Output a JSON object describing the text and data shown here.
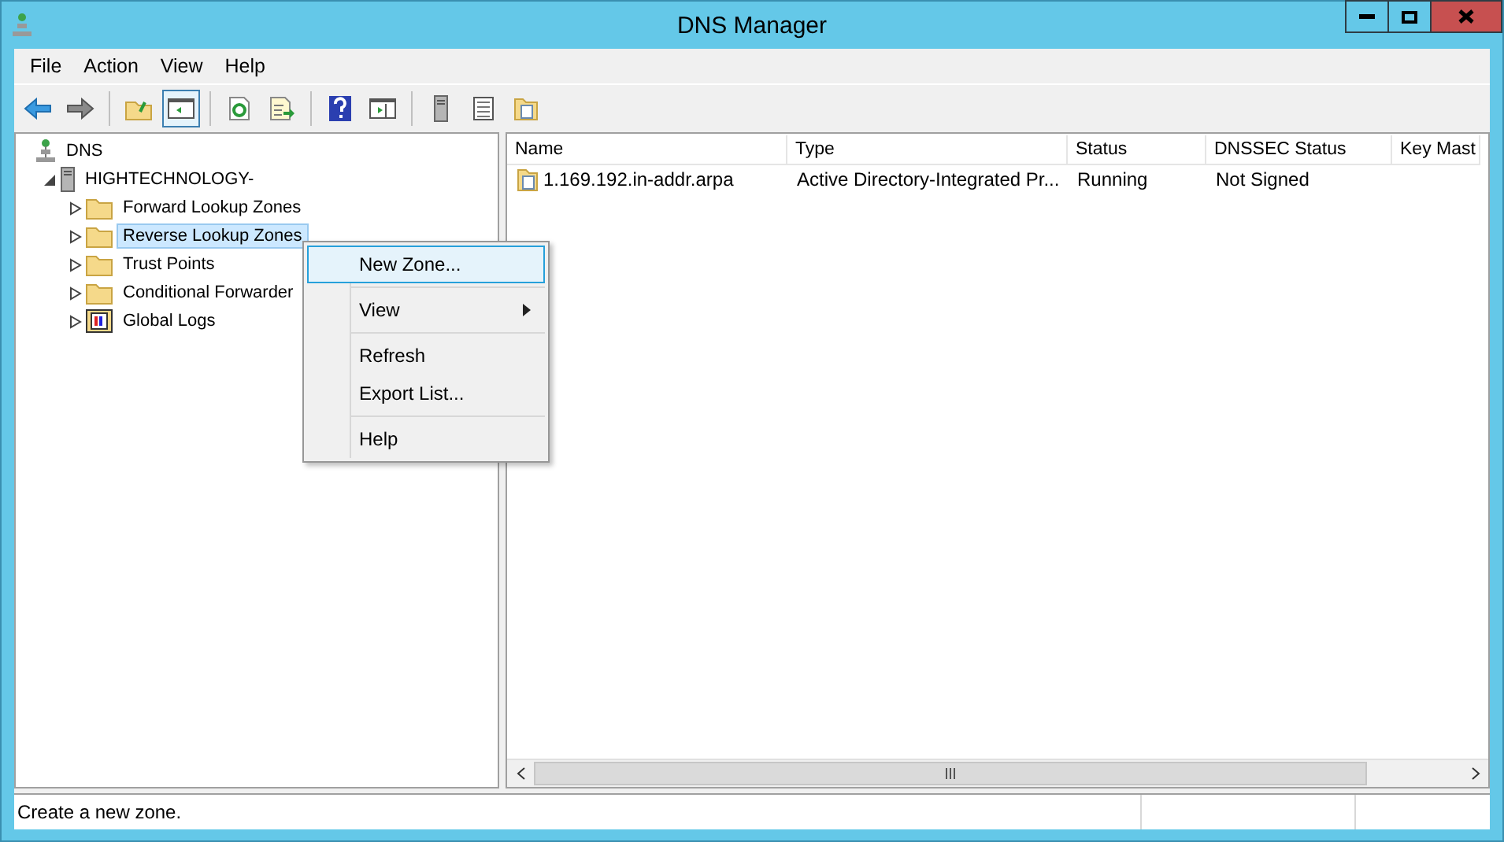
{
  "window": {
    "title": "DNS Manager"
  },
  "menu_bar": [
    "File",
    "Action",
    "View",
    "Help"
  ],
  "tree": [
    {
      "label": "DNS",
      "kind": "dns",
      "selected": false,
      "children": [
        {
          "label": "HIGHTECHNOLOGY-",
          "kind": "server",
          "selected": false,
          "expanded": true,
          "children": [
            {
              "label": "Forward Lookup Zones",
              "kind": "folder",
              "selected": false,
              "expanded": false
            },
            {
              "label": "Reverse Lookup Zones",
              "kind": "folder",
              "selected": true,
              "expanded": false
            },
            {
              "label": "Trust Points",
              "kind": "folder",
              "selected": false,
              "expanded": false
            },
            {
              "label": "Conditional Forwarder",
              "kind": "folder",
              "selected": false,
              "expanded": false
            },
            {
              "label": "Global Logs",
              "kind": "logs",
              "selected": false,
              "expanded": false
            }
          ]
        }
      ]
    }
  ],
  "context_menu": [
    [
      {
        "label": "New Zone...",
        "selected": true,
        "submenu": false
      }
    ],
    [
      {
        "label": "View",
        "selected": false,
        "submenu": true
      }
    ],
    [
      {
        "label": "Refresh",
        "selected": false,
        "submenu": false
      },
      {
        "label": "Export List...",
        "selected": false,
        "submenu": false
      }
    ],
    [
      {
        "label": "Help",
        "selected": false,
        "submenu": false
      }
    ]
  ],
  "table": {
    "columns": [
      "Name",
      "Type",
      "Status",
      "DNSSEC Status",
      "Key Mast"
    ],
    "rows": [
      [
        "1.169.192.in-addr.arpa",
        "Active Directory-Integrated Pr...",
        "Running",
        "Not Signed"
      ]
    ]
  },
  "status_bar": "Create a new zone."
}
